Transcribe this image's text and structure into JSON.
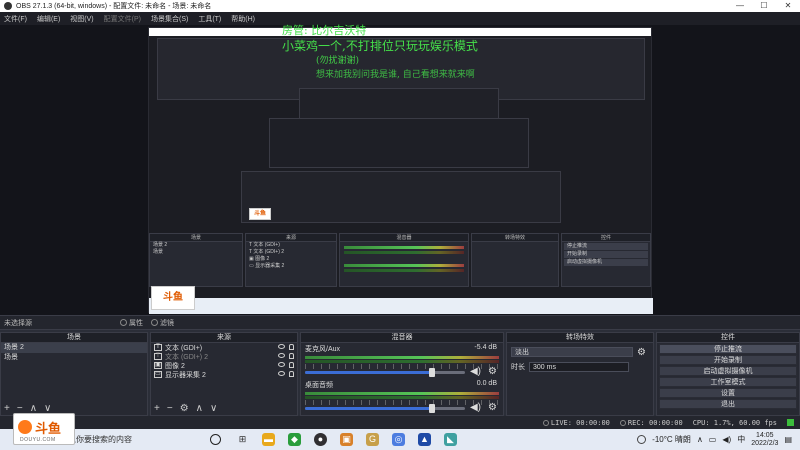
{
  "window": {
    "title": "OBS 27.1.3 (64-bit, windows) - 配置文件: 未命名 - 场景: 未命名",
    "controls": [
      "—",
      "☐",
      "✕"
    ]
  },
  "menu": [
    "文件(F)",
    "编辑(E)",
    "视图(V)",
    "配置文件(P)",
    "场景集合(S)",
    "工具(T)",
    "帮助(H)"
  ],
  "overlay": {
    "line1": "房管: 比尔吉沃特",
    "line2": "小菜鸡一个,不打排位只玩玩娱乐模式",
    "line3": "(勿扰谢谢)",
    "line4": "想来加我别问我是谁, 自己看想来就来啊"
  },
  "source_bar": {
    "label": "未选择源",
    "properties": "属性",
    "filters": "滤镜"
  },
  "scenes": {
    "title": "场景",
    "items": [
      "场景 2",
      "场景"
    ]
  },
  "sources": {
    "title": "来源",
    "items": [
      {
        "icon": "text-icon",
        "glyph": "T",
        "label": "文本 (GDI+)"
      },
      {
        "icon": "text-icon",
        "glyph": "T",
        "label": "文本 (GDI+) 2"
      },
      {
        "icon": "image-icon",
        "glyph": "▣",
        "label": "图像 2"
      },
      {
        "icon": "display-icon",
        "glyph": "▭",
        "label": "显示器采集 2"
      }
    ]
  },
  "mixer": {
    "title": "混音器",
    "channels": [
      {
        "name": "麦克风/Aux",
        "db": "-5.4 dB",
        "level": 0.78
      },
      {
        "name": "桌面音频",
        "db": "0.0 dB",
        "level": 0.8
      }
    ]
  },
  "transitions": {
    "title": "转场特效",
    "selected": "淡出",
    "duration_label": "时长",
    "duration": "300 ms"
  },
  "controls": {
    "title": "控件",
    "buttons": [
      "停止推流",
      "开始录制",
      "启动虚拟摄像机",
      "工作室模式",
      "设置",
      "退出"
    ]
  },
  "status": {
    "live": "LIVE: 00:00:00",
    "rec": "REC: 00:00:00",
    "cpu": "CPU: 1.7%, 60.00 fps"
  },
  "taskbar": {
    "search_text": "入你要搜索的内容",
    "weather": "-10°C 晴朗",
    "time": "14:05",
    "date": "2022/2/3",
    "ime": "中",
    "apps": [
      {
        "icon": "circle-icon",
        "glyph": "O",
        "color": "#222222"
      },
      {
        "icon": "task-view-icon",
        "glyph": "⊞",
        "color": "#333333"
      },
      {
        "icon": "folder-icon",
        "glyph": "▬",
        "color": "#e8a91c"
      },
      {
        "icon": "store-icon",
        "glyph": "◆",
        "color": "#2a9d3c"
      },
      {
        "icon": "obs-icon",
        "glyph": "●",
        "color": "#302e31"
      },
      {
        "icon": "box-icon",
        "glyph": "▣",
        "color": "#d8812a"
      },
      {
        "icon": "game-icon",
        "glyph": "G",
        "color": "#c7a04a"
      },
      {
        "icon": "app-icon",
        "glyph": "◎",
        "color": "#4c7de0"
      },
      {
        "icon": "lol-icon",
        "glyph": "▲",
        "color": "#1e4aa6"
      },
      {
        "icon": "client-icon",
        "glyph": "◣",
        "color": "#3fa0a0"
      }
    ]
  },
  "watermark": {
    "brand": "斗鱼",
    "sub": "DOUYU.COM"
  }
}
